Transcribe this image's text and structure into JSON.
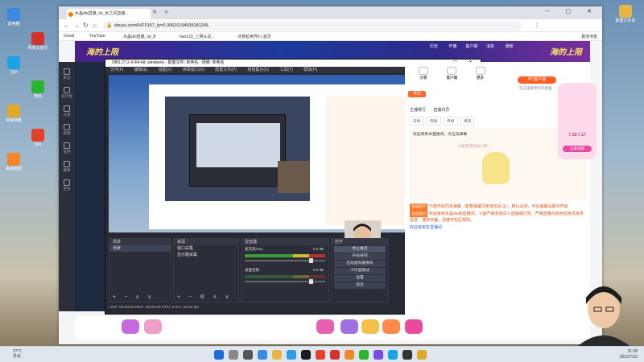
{
  "desktop": {
    "icons_left": [
      {
        "label": "此电脑",
        "color": "#3a8be0"
      },
      {
        "label": "网易云音乐",
        "color": "#d4322d"
      },
      {
        "label": "QQ",
        "color": "#1aa3e8"
      },
      {
        "label": "微信",
        "color": "#2ab52c"
      },
      {
        "label": "百度网盘",
        "color": "#e0a92a"
      },
      {
        "label": "360",
        "color": "#e3422a"
      },
      {
        "label": "桌面截图",
        "color": "#f2862a"
      }
    ],
    "icons_right": [
      {
        "label": "新建文件夹",
        "color": "#e7b643"
      }
    ]
  },
  "browser": {
    "tab_title": "水晶dio直播_lol_女之风直播...",
    "url": "douyu.com/6475157_ty=0.30620194939181266",
    "bookmarks": [
      "Gmail",
      "YouTube",
      "水晶dio直播_lol_B",
      "han123_上网从这...",
      "冰梦起世界5 | 首页"
    ],
    "bookmarks_right": "其他书签"
  },
  "page": {
    "banner_left": "海的上限",
    "banner_right": "海的上限",
    "topnav": [
      "历史",
      "开播",
      "客户端",
      "消息",
      "通知"
    ],
    "sidebar": [
      "关注",
      "排行榜",
      "分类",
      "视频",
      "鱼吧",
      "赛事",
      "更多"
    ],
    "obs": {
      "title": "OBS 27.2.4 (64-bit, windows) - 配置文件: 未命名 - 场景: 未命名",
      "menu": [
        "文件(F)",
        "编辑(E)",
        "视图(V)",
        "停靠窗口(D)",
        "配置文件(P)",
        "场景集合(S)",
        "工具(T)",
        "帮助(H)"
      ],
      "scenes_header": "场景",
      "scenes": [
        "场景"
      ],
      "sources_header": "来源",
      "sources": [
        "窗口采集",
        "显示器采集"
      ],
      "mixer_header": "混音器",
      "mixer": [
        {
          "name": "麦克风/Aux",
          "db": "0.0 dB"
        },
        {
          "name": "桌面音频",
          "db": "0.0 dB"
        }
      ],
      "controls_header": "控件",
      "controls": [
        "停止推流",
        "开始录制",
        "启动虚拟摄像机",
        "工作室模式",
        "设置",
        "退出"
      ],
      "status": "LIVE: 00:00:00   REC: 00:00:00   CPU: 3.5%, 60.00 fps"
    },
    "right": {
      "icons": [
        "分享",
        "客户端",
        "更多"
      ],
      "pc_badge": "PC客户端",
      "pc_sub": "在这里看更好的直播",
      "follow": "关注",
      "tabs": [
        "主播排行",
        "直播日历"
      ],
      "sub_tabs": [
        "日榜",
        "周榜",
        "月榜",
        "贵宾"
      ],
      "danmu_hint": "欢迎来到本直播间，点击去弹幕",
      "danmu_btn": "成为贵族",
      "mascot_caption": "大鱼在等你加入哦~",
      "chat": [
        {
          "tag": "系统提示",
          "text": "已经开启同步弹幕（若要弹幕同步增加关注），默认关闭，可在弹幕设置中开启"
        },
        {
          "tag": "系统提示",
          "text": "欢迎来到水晶dio的直播间，斗鱼严禁未成年人直播或打赏，严禁直播内容含有违法违规信息，谨防诈骗，请遵守社区规则。"
        },
        {
          "tag": "",
          "text": "欢迎来到本直播间"
        }
      ],
      "input_placeholder": "这里输入聊天内容"
    },
    "promo": {
      "date": "7.15-7.17",
      "btn": "立即领取"
    }
  },
  "taskbar": {
    "weather_temp": "27°C",
    "weather_desc": "多云",
    "time": "21:38",
    "date": "2022/7/15"
  }
}
